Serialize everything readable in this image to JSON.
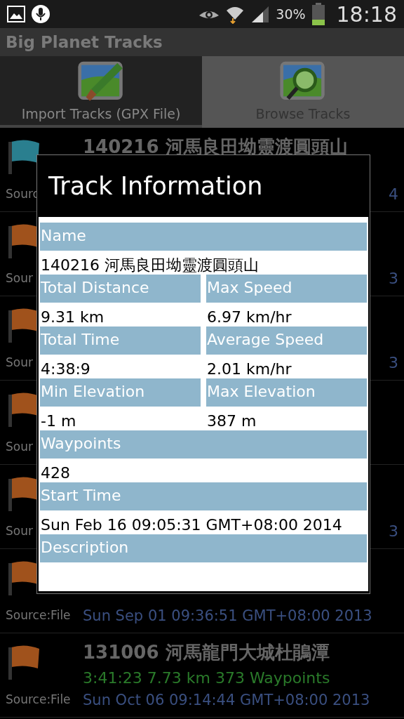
{
  "status_bar": {
    "battery": "30%",
    "time": "18:18"
  },
  "app_title": "Big Planet Tracks",
  "tabs": [
    {
      "label": "Import Tracks (GPX File)",
      "selected": false,
      "kind": "import"
    },
    {
      "label": "Browse Tracks",
      "selected": true,
      "kind": "browse"
    }
  ],
  "tracks": [
    {
      "color": "#2a7f8f",
      "source": "Sourc",
      "title": "140216 河馬良田坳靈渡圓頭山",
      "date_tail": "4"
    },
    {
      "color": "#a0521c",
      "source": "Sour",
      "date_tail": "3"
    },
    {
      "color": "#a0521c",
      "source": "Sour",
      "date_tail": "3"
    },
    {
      "color": "#a0521c",
      "source": "Sour"
    },
    {
      "color": "#a0521c",
      "source": "Sour",
      "date_tail": "3"
    },
    {
      "color": "#a0521c",
      "source": "Source:File",
      "date": "Sun Sep 01 09:36:51 GMT+08:00 2013"
    },
    {
      "color": "#a0521c",
      "source": "Source:File",
      "title": "131006 河馬龍門大城杜鵑潭",
      "stats": "3:41:23  7.73 km  373 Waypoints",
      "date": "Sun Oct 06 09:14:44 GMT+08:00 2013"
    }
  ],
  "dialog": {
    "title": "Track Information",
    "fields": [
      {
        "kind": "full",
        "label": "Name",
        "value": "140216 河馬良田坳靈渡圓頭山"
      },
      {
        "kind": "half",
        "label": "Total Distance",
        "value": "9.31 km"
      },
      {
        "kind": "half",
        "label": "Max Speed",
        "value": "6.97 km/hr"
      },
      {
        "kind": "half",
        "label": "Total Time",
        "value": "4:38:9"
      },
      {
        "kind": "half",
        "label": "Average Speed",
        "value": "2.01 km/hr"
      },
      {
        "kind": "half",
        "label": "Min Elevation",
        "value": "-1 m"
      },
      {
        "kind": "half",
        "label": "Max Elevation",
        "value": "387 m"
      },
      {
        "kind": "full",
        "label": "Waypoints",
        "value": "428"
      },
      {
        "kind": "full",
        "label": "Start Time",
        "value": "Sun Feb 16 09:05:31 GMT+08:00 2014"
      },
      {
        "kind": "full",
        "label": "Description"
      }
    ]
  }
}
